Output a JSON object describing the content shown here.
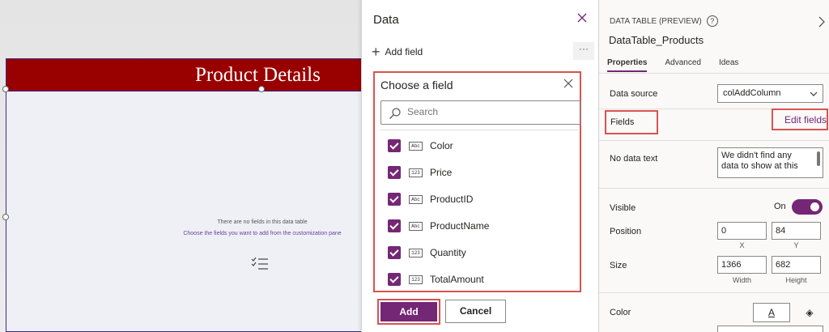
{
  "canvas": {
    "header_title": "Product Details",
    "empty_message": "There are no fields in this data table",
    "empty_hint": "Choose the fields you want to add from the customization pane",
    "header_color": "#990000"
  },
  "data_panel": {
    "title": "Data",
    "add_field_label": "Add field",
    "more_label": "···",
    "chooser": {
      "title": "Choose a field",
      "search_placeholder": "Search",
      "fields": [
        {
          "name": "Color",
          "type": "Abc",
          "checked": true
        },
        {
          "name": "Price",
          "type": "123",
          "checked": true
        },
        {
          "name": "ProductID",
          "type": "Abc",
          "checked": true
        },
        {
          "name": "ProductName",
          "type": "Abc",
          "checked": true
        },
        {
          "name": "Quantity",
          "type": "123",
          "checked": true
        },
        {
          "name": "TotalAmount",
          "type": "123",
          "checked": true
        }
      ]
    },
    "add_button": "Add",
    "cancel_button": "Cancel"
  },
  "properties": {
    "kicker": "DATA TABLE (PREVIEW)",
    "help": "?",
    "control_name": "DataTable_Products",
    "tabs": [
      "Properties",
      "Advanced",
      "Ideas"
    ],
    "data_source_label": "Data source",
    "data_source_value": "colAddColumn",
    "fields_label": "Fields",
    "edit_fields_label": "Edit fields",
    "no_data_text_label": "No data text",
    "no_data_text_value": "We didn't find any data to show at this",
    "visible_label": "Visible",
    "visible_state": "On",
    "position_label": "Position",
    "position_x": "0",
    "position_y": "84",
    "x_label": "X",
    "y_label": "Y",
    "size_label": "Size",
    "size_width": "1366",
    "size_height": "682",
    "width_label": "Width",
    "height_label": "Height",
    "color_label": "Color",
    "color_text_glyph": "A",
    "fill_glyph": "◈",
    "accent_color": "#742774"
  }
}
